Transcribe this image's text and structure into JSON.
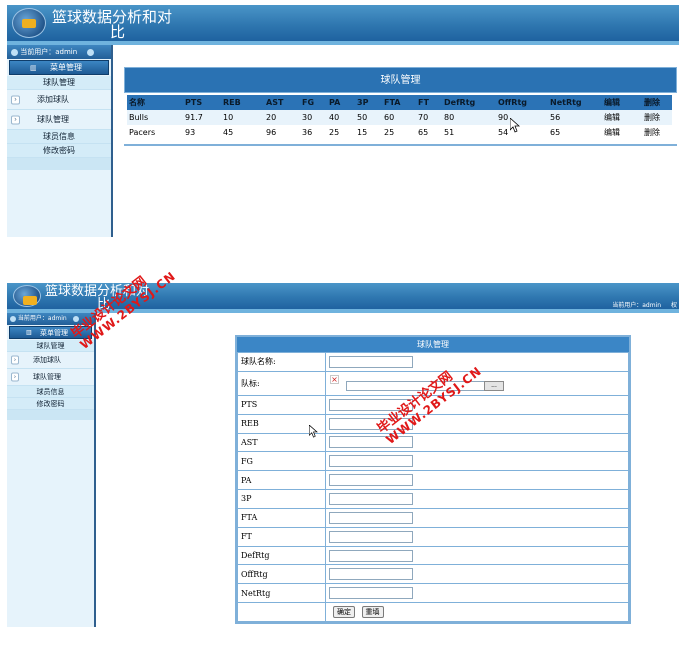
{
  "app": {
    "title_line1": "篮球数据分析和对",
    "title_line2": "比"
  },
  "user": {
    "label": "当前用户：admin",
    "top_right_label": "当前用户：admin",
    "top_right_extra": "权"
  },
  "sidebar": {
    "menu_header": "菜单管理",
    "items": [
      {
        "label": "球队管理",
        "type": "sub"
      },
      {
        "label": "添加球队",
        "type": "expand"
      },
      {
        "label": "球队管理",
        "type": "expand"
      },
      {
        "label": "球员信息",
        "type": "sub"
      },
      {
        "label": "修改密码",
        "type": "sub"
      }
    ]
  },
  "team_list": {
    "title": "球队管理",
    "columns": [
      "名称",
      "PTS",
      "REB",
      "AST",
      "FG",
      "PA",
      "3P",
      "FTA",
      "FT",
      "DefRtg",
      "OffRtg",
      "NetRtg",
      "编辑",
      "删除"
    ],
    "rows": [
      [
        "Bulls",
        "91.7",
        "10",
        "20",
        "30",
        "40",
        "50",
        "60",
        "70",
        "80",
        "90",
        "56",
        "编辑",
        "删除"
      ],
      [
        "Pacers",
        "93",
        "45",
        "96",
        "36",
        "25",
        "15",
        "25",
        "65",
        "51",
        "54",
        "65",
        "编辑",
        "删除"
      ]
    ]
  },
  "team_form": {
    "title": "球队管理",
    "fields": [
      {
        "label": "球队名称:",
        "type": "text",
        "value": ""
      },
      {
        "label": "队标:",
        "type": "file",
        "value": ""
      },
      {
        "label": "PTS",
        "type": "text",
        "value": ""
      },
      {
        "label": "REB",
        "type": "text",
        "value": ""
      },
      {
        "label": "AST",
        "type": "text",
        "value": ""
      },
      {
        "label": "FG",
        "type": "text",
        "value": ""
      },
      {
        "label": "PA",
        "type": "text",
        "value": ""
      },
      {
        "label": "3P",
        "type": "text",
        "value": ""
      },
      {
        "label": "FTA",
        "type": "text",
        "value": ""
      },
      {
        "label": "FT",
        "type": "text",
        "value": ""
      },
      {
        "label": "DefRtg",
        "type": "text",
        "value": ""
      },
      {
        "label": "OffRtg",
        "type": "text",
        "value": ""
      },
      {
        "label": "NetRtg",
        "type": "text",
        "value": ""
      }
    ],
    "browse_label": "...",
    "submit_label": "确定",
    "reset_label": "重填"
  },
  "watermark": {
    "line1": "毕业设计论文网",
    "line2": "WWW.2BYSJ.CN"
  },
  "colors": {
    "header_blue": "#2f77b0",
    "table_header": "#2b73b6",
    "watermark_red": "#e01818"
  }
}
